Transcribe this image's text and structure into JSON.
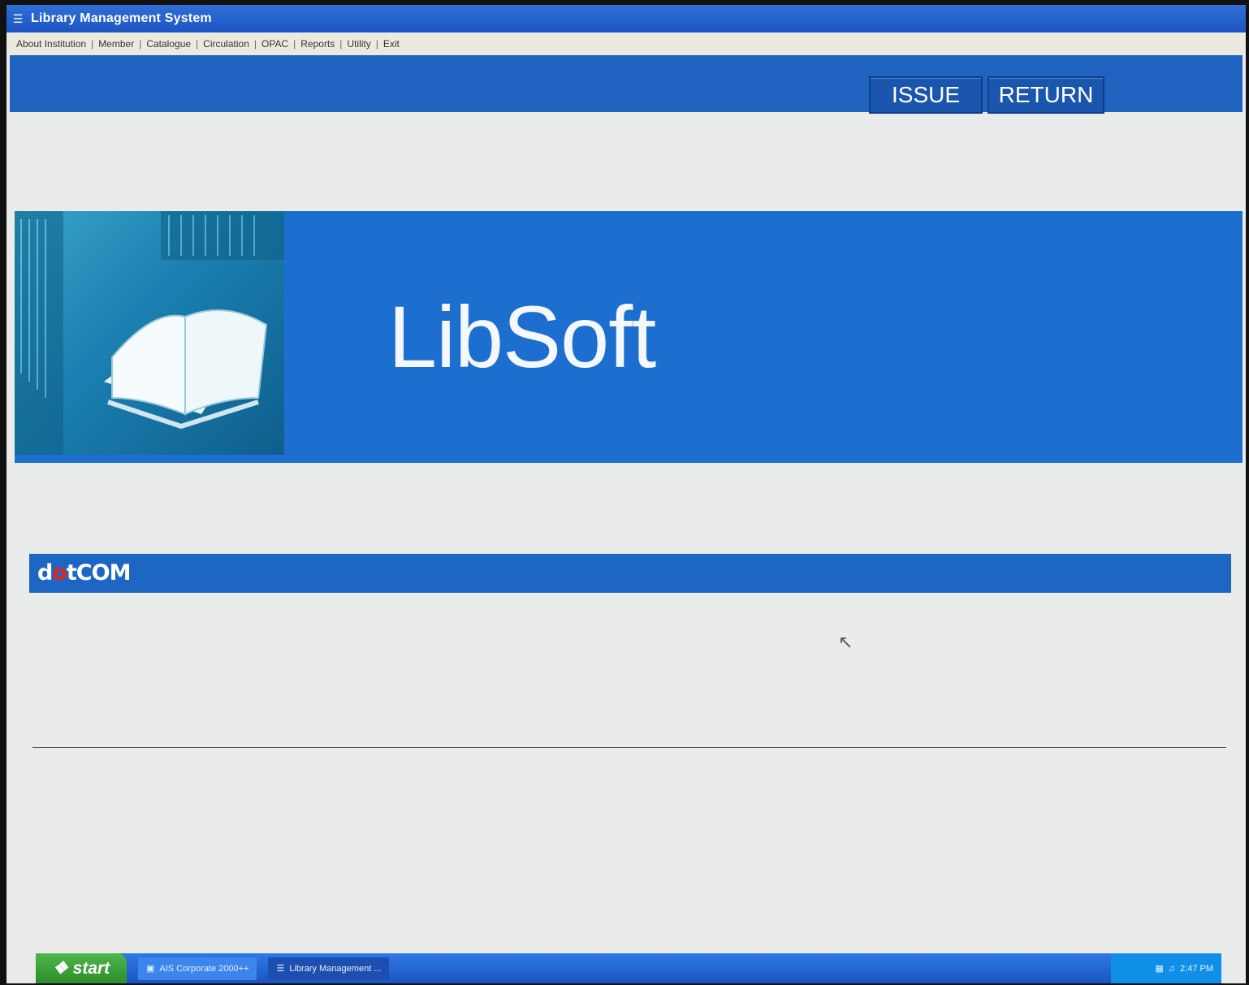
{
  "window": {
    "title": "Library Management System",
    "icon": "book-app-icon",
    "controls": [
      "minimize",
      "restore",
      "close"
    ]
  },
  "menu": {
    "items": [
      "About Institution",
      "Member",
      "Catalogue",
      "Circulation",
      "OPAC",
      "Reports",
      "Utility",
      "Exit"
    ]
  },
  "actions": {
    "issue_label": "ISSUE",
    "return_label": "RETURN"
  },
  "banner": {
    "brand": "LibSoft",
    "photo_icon": "open-book-library-image"
  },
  "footer": {
    "logo_prefix": "d",
    "logo_dot": "o",
    "logo_suffix": "tCOM"
  },
  "taskbar": {
    "start_label": "start",
    "tasks": [
      "AIS Corporate 2000++",
      "Library Management ..."
    ],
    "clock": "2:47 PM"
  },
  "colors": {
    "brand_blue": "#1d6fcf",
    "band_blue": "#1f62c0",
    "background": "#e9ecea"
  }
}
